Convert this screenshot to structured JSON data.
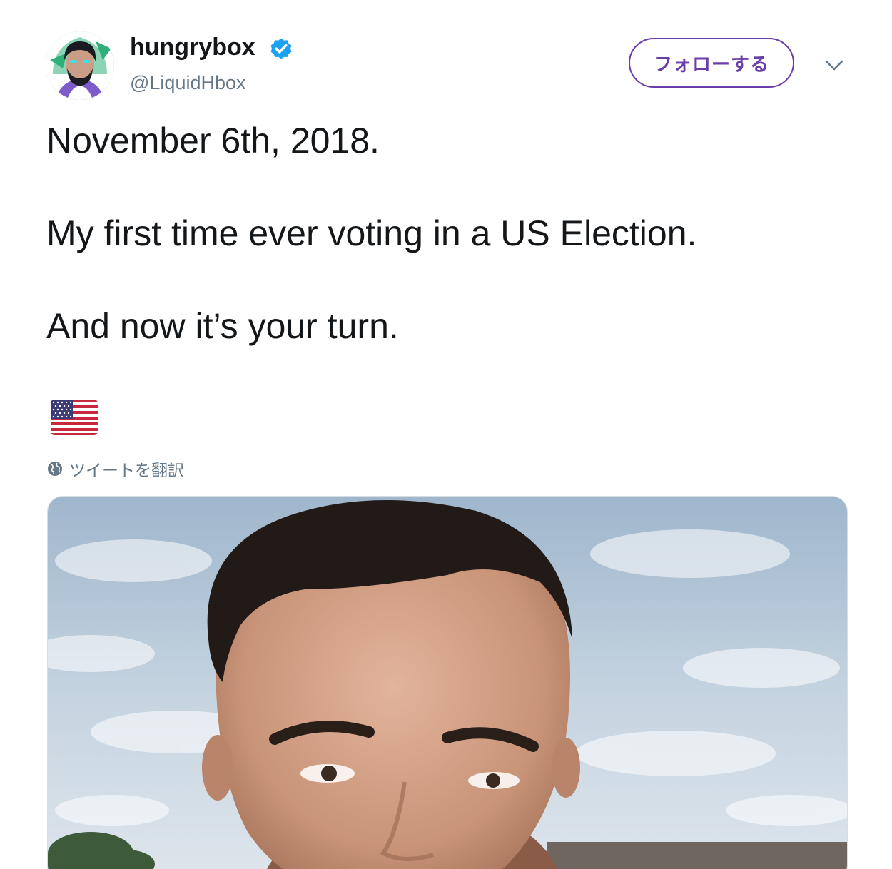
{
  "author": {
    "display_name": "hungrybox",
    "handle": "@LiquidHbox",
    "verified": true
  },
  "actions": {
    "follow_label": "フォローする"
  },
  "tweet": {
    "line1": "November 6th, 2018.",
    "line2": "My first time ever voting in a US Election.",
    "line3": "And now it’s your turn.",
    "emoji": "us-flag"
  },
  "translate": {
    "label": "ツイートを翻訳"
  },
  "icons": {
    "verified": "verified-badge-icon",
    "caret": "chevron-down-icon",
    "globe": "globe-icon",
    "flag": "us-flag-icon"
  },
  "colors": {
    "accent": "#6a3da8",
    "verified": "#1da1f2",
    "secondary_text": "#657786",
    "primary_text": "#14171a"
  }
}
